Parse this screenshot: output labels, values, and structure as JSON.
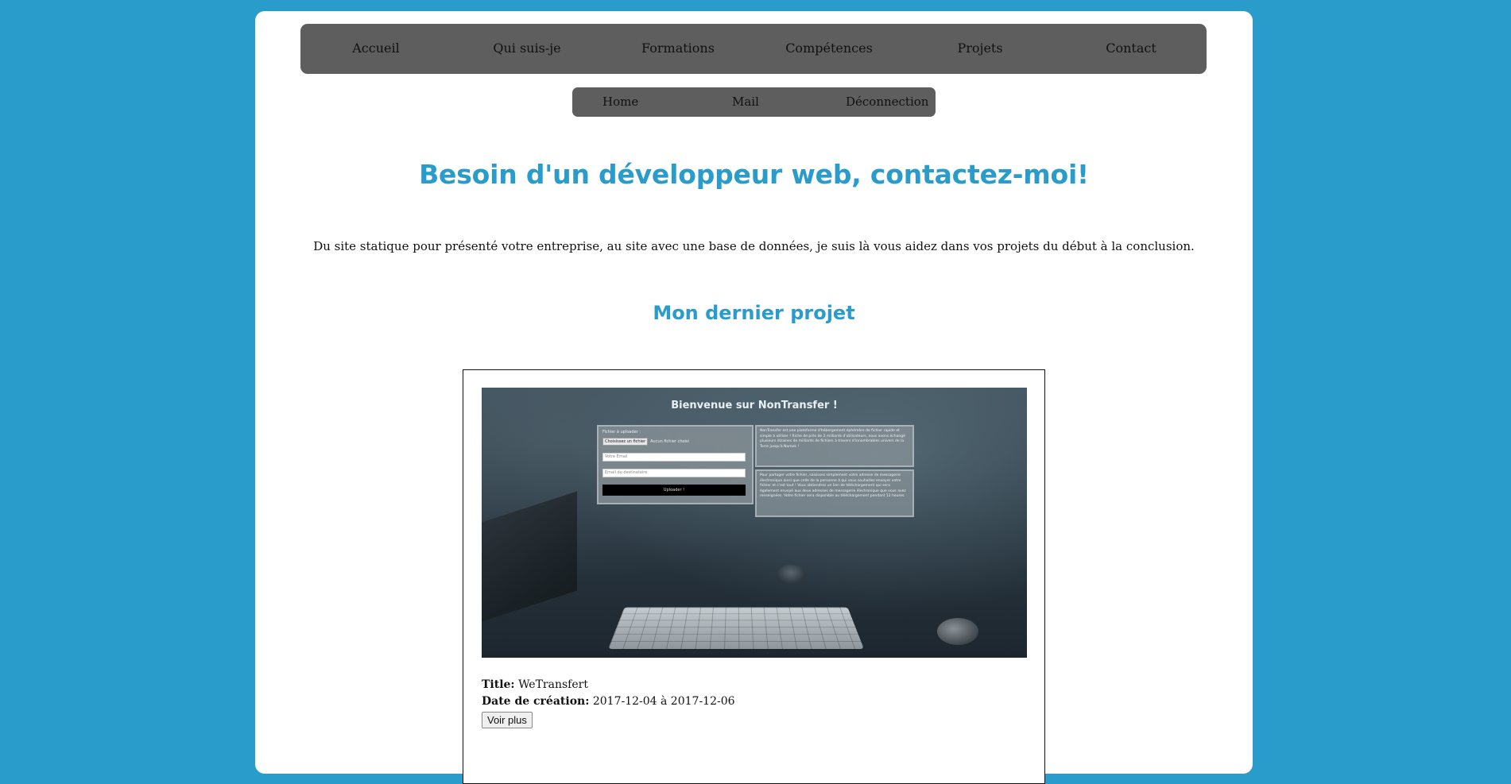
{
  "main_nav": {
    "items": [
      {
        "label": "Accueil"
      },
      {
        "label": "Qui suis-je"
      },
      {
        "label": "Formations"
      },
      {
        "label": "Compétences"
      },
      {
        "label": "Projets"
      },
      {
        "label": "Contact"
      }
    ]
  },
  "sub_nav": {
    "items": [
      {
        "label": "Home"
      },
      {
        "label": "Mail"
      },
      {
        "label": "Déconnection"
      }
    ]
  },
  "headline": "Besoin d'un développeur web, contactez-moi!",
  "intro": "Du site statique pour présenté votre entreprise, au site avec une base de données, je suis là vous aidez dans vos projets du début à la conclusion.",
  "section_title": "Mon dernier projet",
  "project": {
    "screenshot": {
      "title": "Bienvenue sur NonTransfer !",
      "form_label": "Fichier à uploader :",
      "file_button": "Choisissez un fichier",
      "file_status": "Aucun fichier choisi",
      "email_placeholder": "Votre Email",
      "dest_placeholder": "Email du destinataire",
      "upload_button": "Uploader !",
      "info_1": "NonTransfer est une plateforme d'hébergement éphémère de fichier rapide et simple à utiliser ! Riche de près de 2 milliards d'utilisateurs, nous avons échangé plusieurs dizaines de milliards de fichiers à travers d'innombrables univers de la Terre jusqu'à Namek !",
      "info_2": "Pour partager votre fichier, saisissez simplement votre adresse de messagerie électronique ainsi que celle de la personne à qui vous souhaitez envoyer votre fichier et c'est tout ! Vous obtiendrez un lien de téléchargement qui sera également envoyé aux deux adresses de messagerie électronique que vous avez renseignées. Votre fichier sera disponible au téléchargement pendant 12 heures."
    },
    "title_label": "Title:",
    "title_value": "WeTransfert",
    "date_label": "Date de création:",
    "date_value": "2017-12-04 à 2017-12-06",
    "more_button": "Voir plus"
  },
  "colors": {
    "background": "#2a9ccb",
    "accent": "#2a9ccb",
    "nav": "#5e5e5e"
  }
}
